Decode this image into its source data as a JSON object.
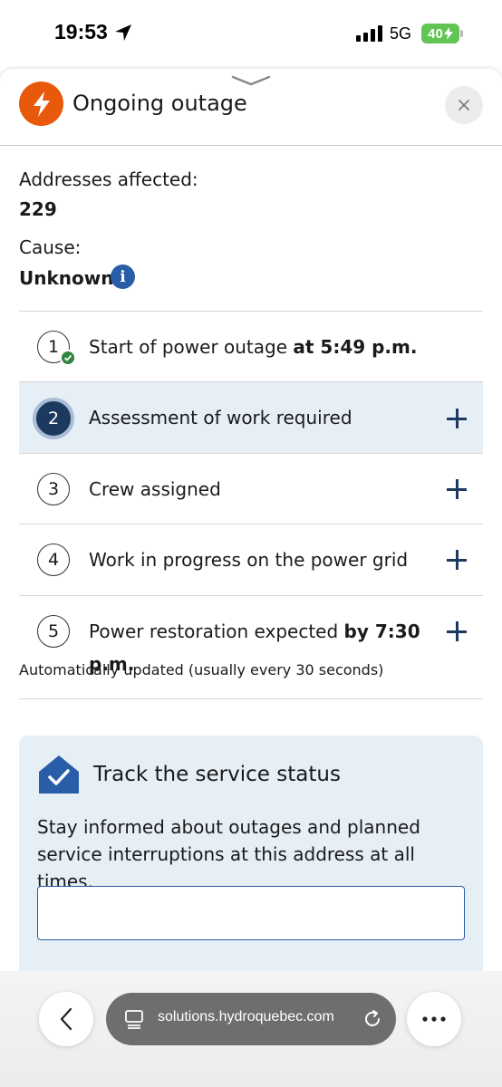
{
  "status_bar": {
    "time": "19:53",
    "network": "5G",
    "battery": "40"
  },
  "header": {
    "title": "Ongoing outage"
  },
  "info": {
    "addresses_label": "Addresses affected:",
    "addresses_value": "229",
    "cause_label": "Cause:",
    "cause_value": "Unknown"
  },
  "steps": [
    {
      "number": "1",
      "text": "Start of power outage ",
      "bold": "at 5:49 p.m.",
      "completed": true,
      "active": false
    },
    {
      "number": "2",
      "text": "Assessment of work required",
      "bold": "",
      "completed": false,
      "active": true
    },
    {
      "number": "3",
      "text": "Crew assigned",
      "bold": "",
      "completed": false,
      "active": false
    },
    {
      "number": "4",
      "text": "Work in progress on the power grid",
      "bold": "",
      "completed": false,
      "active": false
    },
    {
      "number": "5",
      "text": "Power restoration expected ",
      "bold": "by 7:30 p.m.",
      "completed": false,
      "active": false
    }
  ],
  "auto_update_note": "Automatically updated (usually every 30 seconds)",
  "track": {
    "title": "Track the service status",
    "description": "Stay informed about outages and planned service interruptions at this address at all times."
  },
  "browser": {
    "url": "solutions.hydroquebec.com"
  },
  "colors": {
    "outage": "#e8590c",
    "navy": "#1c3960",
    "info_blue": "#2a5da8",
    "check_green": "#2e8540",
    "card_bg": "#e6eef6"
  }
}
